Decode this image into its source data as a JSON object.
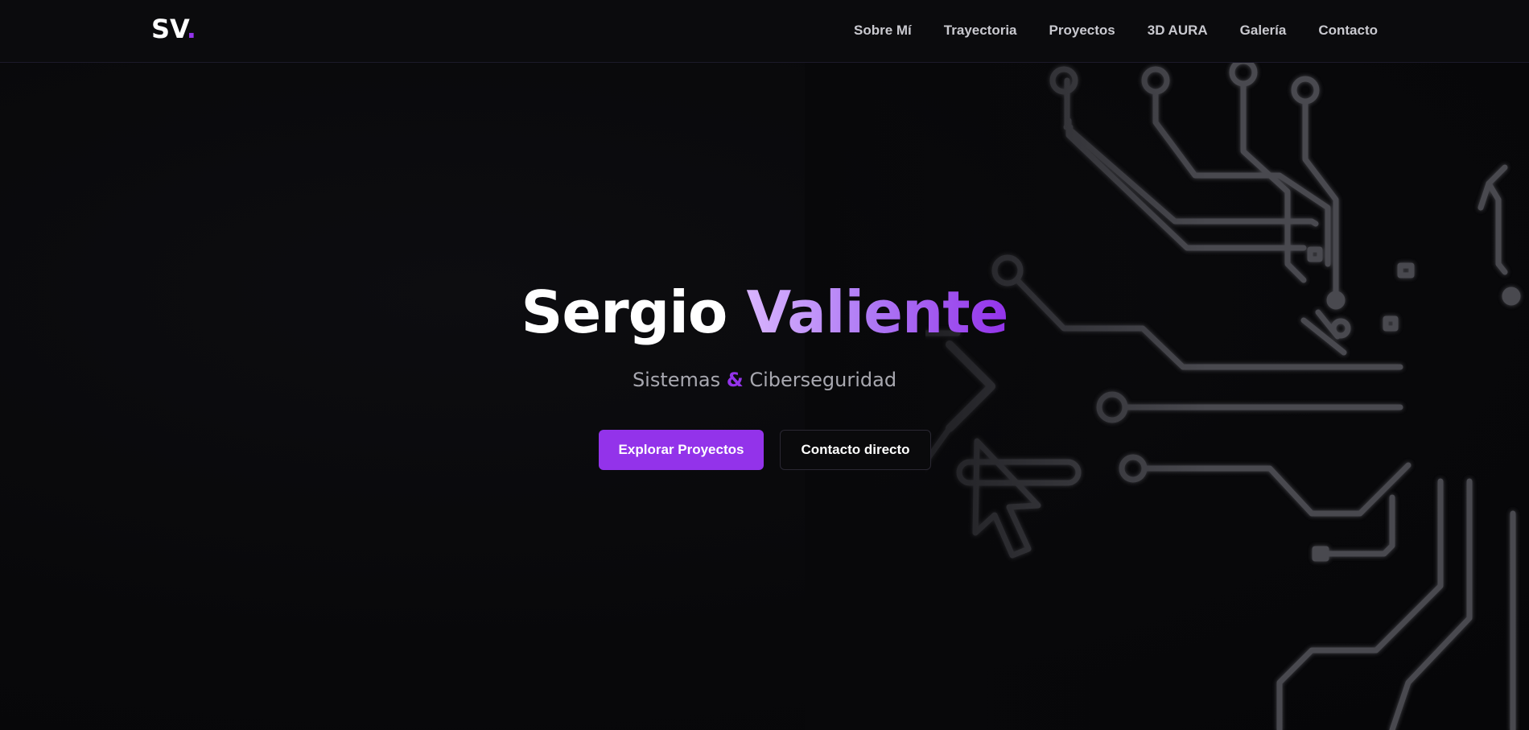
{
  "brand": {
    "logo_text": "SV",
    "logo_dot": "."
  },
  "nav": {
    "items": [
      {
        "label": "Sobre Mí"
      },
      {
        "label": "Trayectoria"
      },
      {
        "label": "Proyectos"
      },
      {
        "label": "3D AURA"
      },
      {
        "label": "Galería"
      },
      {
        "label": "Contacto"
      }
    ]
  },
  "hero": {
    "title_first": "Sergio",
    "title_last": "Valiente",
    "subtitle_part1": "Sistemas",
    "subtitle_amp": "&",
    "subtitle_part2": "Ciberseguridad",
    "primary_button": "Explorar Proyectos",
    "secondary_button": "Contacto directo"
  },
  "decoration": {
    "icon": "circuit-board-with-cursor-icon"
  },
  "colors": {
    "accent": "#9333ea",
    "background": "#0a0a0c",
    "nav_text": "#c9c9cf",
    "subtitle_text": "#a8a8b0",
    "circuit_lines": "#4a4a50"
  }
}
